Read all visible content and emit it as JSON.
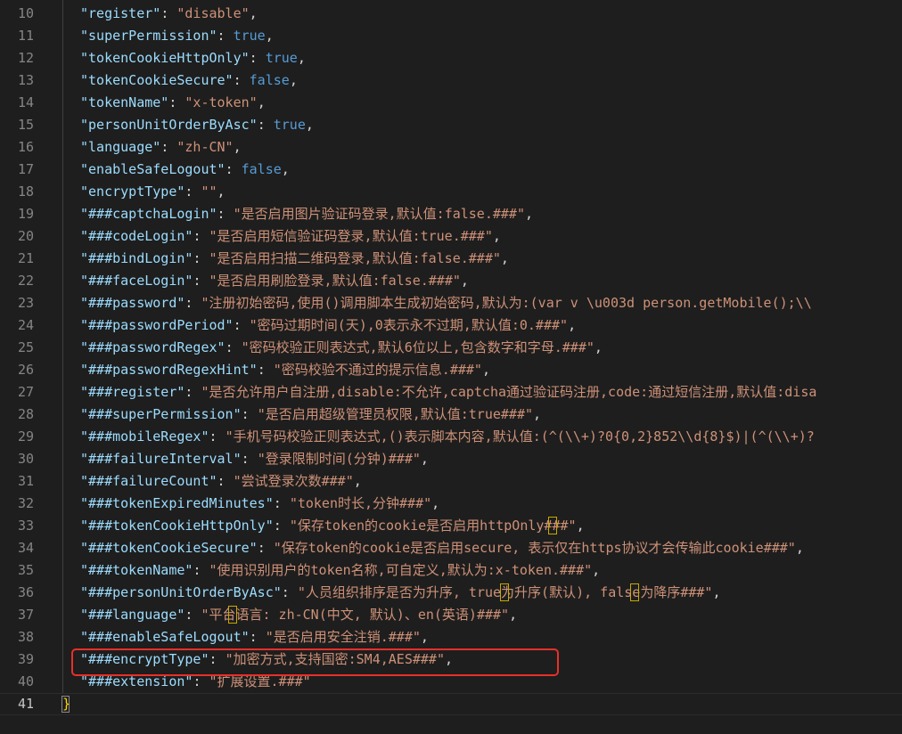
{
  "editor": {
    "active_line": 41,
    "line_numbers": [
      "10",
      "11",
      "12",
      "13",
      "14",
      "15",
      "16",
      "17",
      "18",
      "19",
      "20",
      "21",
      "22",
      "23",
      "24",
      "25",
      "26",
      "27",
      "28",
      "29",
      "30",
      "31",
      "32",
      "33",
      "34",
      "35",
      "36",
      "37",
      "38",
      "39",
      "40",
      "41"
    ],
    "lines": [
      {
        "key": "\"register\"",
        "value": "\"disable\"",
        "type": "str",
        "trail": ","
      },
      {
        "key": "\"superPermission\"",
        "value": "true",
        "type": "bool",
        "trail": ","
      },
      {
        "key": "\"tokenCookieHttpOnly\"",
        "value": "true",
        "type": "bool",
        "trail": ","
      },
      {
        "key": "\"tokenCookieSecure\"",
        "value": "false",
        "type": "bool",
        "trail": ","
      },
      {
        "key": "\"tokenName\"",
        "value": "\"x-token\"",
        "type": "str",
        "trail": ","
      },
      {
        "key": "\"personUnitOrderByAsc\"",
        "value": "true",
        "type": "bool",
        "trail": ","
      },
      {
        "key": "\"language\"",
        "value": "\"zh-CN\"",
        "type": "str",
        "trail": ","
      },
      {
        "key": "\"enableSafeLogout\"",
        "value": "false",
        "type": "bool",
        "trail": ","
      },
      {
        "key": "\"encryptType\"",
        "value": "\"\"",
        "type": "str",
        "trail": ","
      },
      {
        "key": "\"###captchaLogin\"",
        "value": "\"是否启用图片验证码登录,默认值:false.###\"",
        "type": "str",
        "trail": ","
      },
      {
        "key": "\"###codeLogin\"",
        "value": "\"是否启用短信验证码登录,默认值:true.###\"",
        "type": "str",
        "trail": ","
      },
      {
        "key": "\"###bindLogin\"",
        "value": "\"是否启用扫描二维码登录,默认值:false.###\"",
        "type": "str",
        "trail": ","
      },
      {
        "key": "\"###faceLogin\"",
        "value": "\"是否启用刷脸登录,默认值:false.###\"",
        "type": "str",
        "trail": ","
      },
      {
        "key": "\"###password\"",
        "value": "\"注册初始密码,使用()调用脚本生成初始密码,默认为:(var v \\u003d person.getMobile();\\\\",
        "type": "str",
        "trail": ""
      },
      {
        "key": "\"###passwordPeriod\"",
        "value": "\"密码过期时间(天),0表示永不过期,默认值:0.###\"",
        "type": "str",
        "trail": ","
      },
      {
        "key": "\"###passwordRegex\"",
        "value": "\"密码校验正则表达式,默认6位以上,包含数字和字母.###\"",
        "type": "str",
        "trail": ","
      },
      {
        "key": "\"###passwordRegexHint\"",
        "value": "\"密码校验不通过的提示信息.###\"",
        "type": "str",
        "trail": ","
      },
      {
        "key": "\"###register\"",
        "value": "\"是否允许用户自注册,disable:不允许,captcha通过验证码注册,code:通过短信注册,默认值:disa",
        "type": "str",
        "trail": ""
      },
      {
        "key": "\"###superPermission\"",
        "value": "\"是否启用超级管理员权限,默认值:true###\"",
        "type": "str",
        "trail": ","
      },
      {
        "key": "\"###mobileRegex\"",
        "value": "\"手机号码校验正则表达式,()表示脚本内容,默认值:(^(\\\\+)?0{0,2}852\\\\d{8}$)|(^(\\\\+)?",
        "type": "str",
        "trail": ""
      },
      {
        "key": "\"###failureInterval\"",
        "value": "\"登录限制时间(分钟)###\"",
        "type": "str",
        "trail": ","
      },
      {
        "key": "\"###failureCount\"",
        "value": "\"尝试登录次数###\"",
        "type": "str",
        "trail": ","
      },
      {
        "key": "\"###tokenExpiredMinutes\"",
        "value": "\"token时长,分钟###\"",
        "type": "str",
        "trail": ","
      },
      {
        "key": "\"###tokenCookieHttpOnly\"",
        "value": "\"保存token的cookie是否启用httpOnly###\"",
        "type": "str",
        "trail": ","
      },
      {
        "key": "\"###tokenCookieSecure\"",
        "value": "\"保存token的cookie是否启用secure, 表示仅在https协议才会传输此cookie###\"",
        "type": "str",
        "trail": ","
      },
      {
        "key": "\"###tokenName\"",
        "value": "\"使用识别用户的token名称,可自定义,默认为:x-token.###\"",
        "type": "str",
        "trail": ","
      },
      {
        "key": "\"###personUnitOrderByAsc\"",
        "value": "\"人员组织排序是否为升序, true为升序(默认), false为降序###\"",
        "type": "str",
        "trail": ","
      },
      {
        "key": "\"###language\"",
        "value": "\"平台语言: zh-CN(中文, 默认)、en(英语)###\"",
        "type": "str",
        "trail": ","
      },
      {
        "key": "\"###enableSafeLogout\"",
        "value": "\"是否启用安全注销.###\"",
        "type": "str",
        "trail": ","
      },
      {
        "key": "\"###encryptType\"",
        "value": "\"加密方式,支持国密:SM4,AES###\"",
        "type": "str",
        "trail": ","
      },
      {
        "key": "\"###extension\"",
        "value": "\"扩展设置.###\"",
        "type": "str",
        "trail": ""
      }
    ],
    "closing_brace": "}"
  },
  "colors": {
    "background": "#1e1e1e",
    "key": "#9cdcfe",
    "string": "#ce9178",
    "boolean": "#569cd6",
    "line_number": "#858585",
    "annotation_box": "#e8302a"
  }
}
